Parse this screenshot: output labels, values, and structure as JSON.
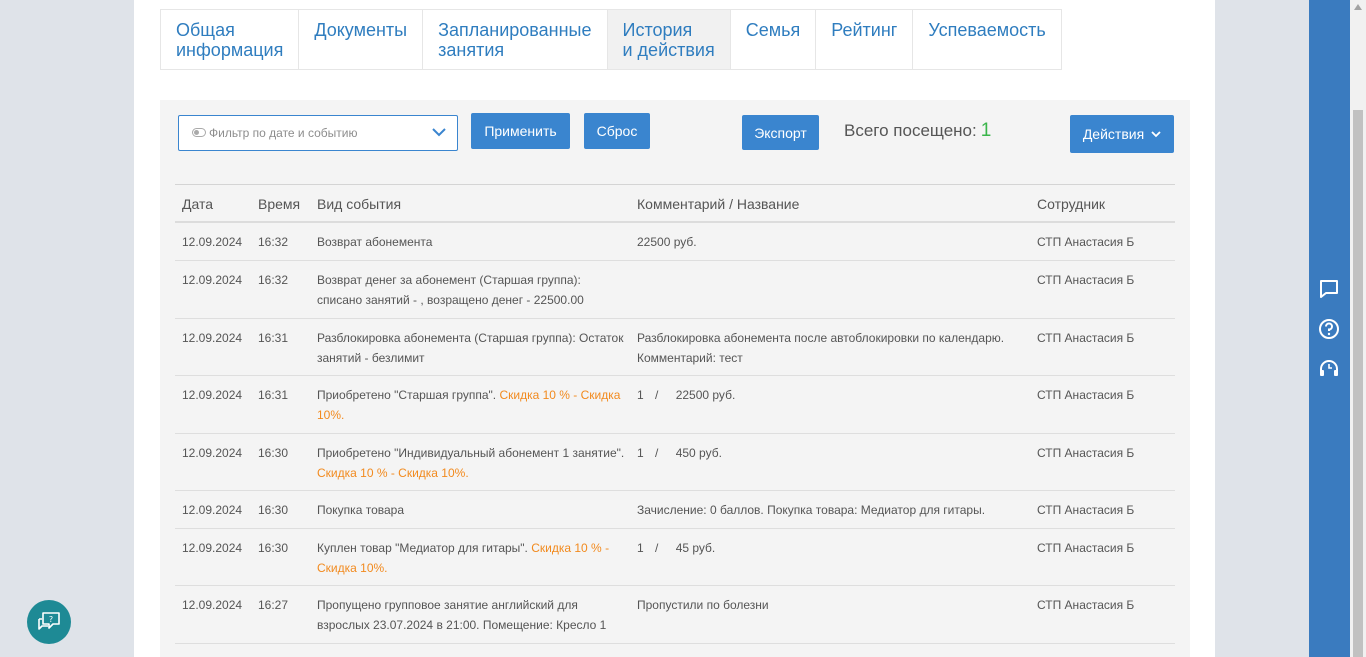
{
  "tabs": [
    {
      "line1": "Общая",
      "line2": "информация"
    },
    {
      "line1": "Документы",
      "line2": ""
    },
    {
      "line1": "Запланированные",
      "line2": "занятия"
    },
    {
      "line1": "История",
      "line2": "и действия"
    },
    {
      "line1": "Семья",
      "line2": ""
    },
    {
      "line1": "Рейтинг",
      "line2": ""
    },
    {
      "line1": "Успеваемость",
      "line2": ""
    }
  ],
  "toolbar": {
    "filter_placeholder": "Фильтр по дате и событию",
    "apply_label": "Применить",
    "reset_label": "Сброс",
    "export_label": "Экспорт",
    "visited_label": "Всего посещено:",
    "visited_count": "1",
    "actions_label": "Действия"
  },
  "table": {
    "headers": {
      "date": "Дата",
      "time": "Время",
      "event": "Вид события",
      "comment": "Комментарий / Название",
      "staff": "Сотрудник"
    },
    "rows": [
      {
        "date": "12.09.2024",
        "time": "16:32",
        "event": "Возврат абонемента",
        "event_discount": "",
        "comment": "22500 руб.",
        "qty": "",
        "staff": "СТП Анастасия Б"
      },
      {
        "date": "12.09.2024",
        "time": "16:32",
        "event": "Возврат денег за абонемент (Старшая группа): списано занятий - , возращено денег - 22500.00",
        "event_discount": "",
        "comment": "",
        "qty": "",
        "staff": "СТП Анастасия Б"
      },
      {
        "date": "12.09.2024",
        "time": "16:31",
        "event": "Разблокировка абонемента (Старшая группа): Остаток занятий - безлимит",
        "event_discount": "",
        "comment": "Разблокировка абонемента после автоблокировки по календарю. Комментарий: тест",
        "qty": "",
        "staff": "СТП Анастасия Б"
      },
      {
        "date": "12.09.2024",
        "time": "16:31",
        "event": "Приобретено \"Старшая группа\".",
        "event_discount": "Скидка 10 % - Скидка 10%.",
        "comment": "22500 руб.",
        "qty": "1",
        "staff": "СТП Анастасия Б"
      },
      {
        "date": "12.09.2024",
        "time": "16:30",
        "event": "Приобретено \"Индивидуальный абонемент 1 занятие\".",
        "event_discount": "Скидка 10 % - Скидка 10%.",
        "comment": "450 руб.",
        "qty": "1",
        "staff": "СТП Анастасия Б"
      },
      {
        "date": "12.09.2024",
        "time": "16:30",
        "event": "Покупка товара",
        "event_discount": "",
        "comment": "Зачисление: 0 баллов. Покупка товара: Медиатор для гитары.",
        "qty": "",
        "staff": "СТП Анастасия Б"
      },
      {
        "date": "12.09.2024",
        "time": "16:30",
        "event": "Куплен товар \"Медиатор для гитары\".",
        "event_discount": "Скидка 10 % - Скидка 10%.",
        "comment": "45 руб.",
        "qty": "1",
        "staff": "СТП Анастасия Б"
      },
      {
        "date": "12.09.2024",
        "time": "16:27",
        "event": "Пропущено групповое занятие английский для взрослых 23.07.2024 в 21:00. Помещение: Кресло 1",
        "event_discount": "",
        "comment": "Пропустили по болезни",
        "qty": "",
        "staff": "СТП Анастасия Б"
      }
    ]
  },
  "colors": {
    "accent": "#3a85cf",
    "sidebar": "#3a7bbf",
    "discount": "#f28a1e",
    "count": "#3ab54a",
    "chat": "#1e8a95"
  },
  "icons": {
    "sidebar": [
      "message-icon",
      "help-icon",
      "support-icon"
    ],
    "chat": "chat-help-icon"
  }
}
